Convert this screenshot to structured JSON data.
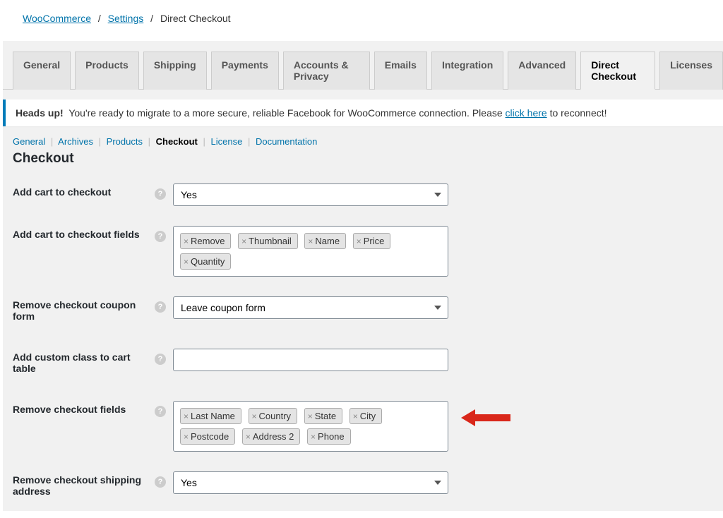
{
  "breadcrumb": {
    "items": [
      {
        "label": "WooCommerce",
        "link": true
      },
      {
        "label": "Settings",
        "link": true
      },
      {
        "label": "Direct Checkout",
        "link": false
      }
    ]
  },
  "tabs": [
    {
      "label": "General"
    },
    {
      "label": "Products"
    },
    {
      "label": "Shipping"
    },
    {
      "label": "Payments"
    },
    {
      "label": "Accounts & Privacy"
    },
    {
      "label": "Emails"
    },
    {
      "label": "Integration"
    },
    {
      "label": "Advanced"
    },
    {
      "label": "Direct Checkout",
      "active": true
    },
    {
      "label": "Licenses"
    }
  ],
  "notice": {
    "bold": "Heads up!",
    "text1": " You're ready to migrate to a more secure, reliable Facebook for WooCommerce connection. Please ",
    "link": "click here",
    "text2": " to reconnect!"
  },
  "subnav": [
    {
      "label": "General"
    },
    {
      "label": "Archives"
    },
    {
      "label": "Products"
    },
    {
      "label": "Checkout",
      "active": true
    },
    {
      "label": "License"
    },
    {
      "label": "Documentation"
    }
  ],
  "section_title": "Checkout",
  "fields": {
    "add_cart_checkout": {
      "label": "Add cart to checkout",
      "value": "Yes"
    },
    "add_cart_fields": {
      "label": "Add cart to checkout fields",
      "tags": [
        "Remove",
        "Thumbnail",
        "Name",
        "Price",
        "Quantity"
      ]
    },
    "remove_coupon": {
      "label": "Remove checkout coupon form",
      "value": "Leave coupon form"
    },
    "custom_class": {
      "label": "Add custom class to cart table",
      "value": ""
    },
    "remove_fields": {
      "label": "Remove checkout fields",
      "tags": [
        "Last Name",
        "Country",
        "State",
        "City",
        "Postcode",
        "Address 2",
        "Phone"
      ]
    },
    "remove_shipping": {
      "label": "Remove checkout shipping address",
      "value": "Yes"
    }
  }
}
